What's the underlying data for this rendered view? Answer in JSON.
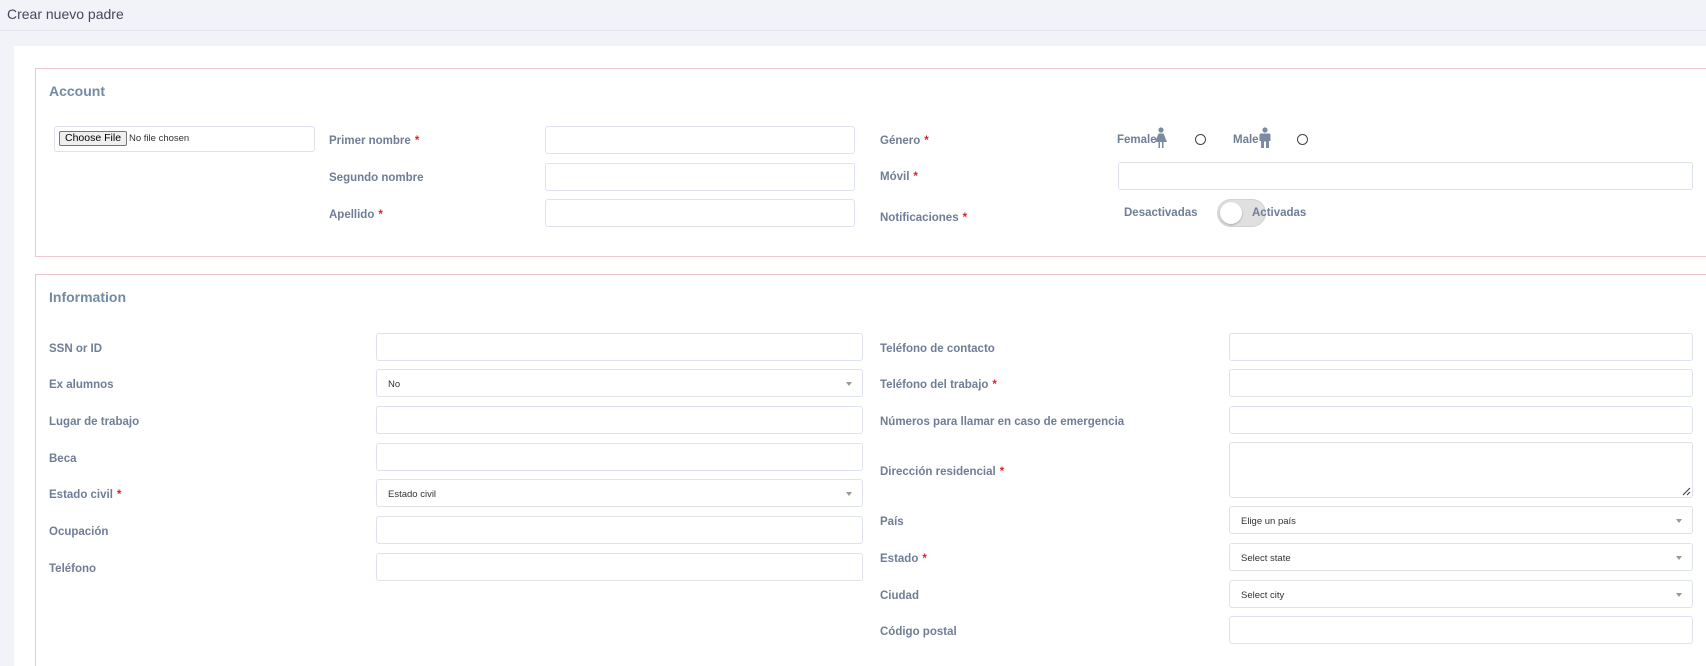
{
  "page": {
    "title": "Crear nuevo padre"
  },
  "account": {
    "title": "Account",
    "file_button": "Choose File",
    "file_status": "No file chosen",
    "first_name_label": "Primer nombre",
    "middle_name_label": "Segundo nombre",
    "last_name_label": "Apellido",
    "gender_label": "Género",
    "female_label": "Female",
    "male_label": "Male",
    "mobile_label": "Móvil",
    "notifications_label": "Notificaciones",
    "notif_off_label": "Desactivadas",
    "notif_on_label": "Activadas",
    "required_mark": "*"
  },
  "information": {
    "title": "Information",
    "ssn_label": "SSN or ID",
    "alumni_label": "Ex alumnos",
    "alumni_value": "No",
    "workplace_label": "Lugar de trabajo",
    "scholarship_label": "Beca",
    "marital_label": "Estado civil",
    "marital_value": "Estado civil",
    "occupation_label": "Ocupación",
    "phone_label": "Teléfono",
    "contact_phone_label": "Teléfono de contacto",
    "work_phone_label": "Teléfono del trabajo",
    "emergency_label": "Números para llamar en caso de emergencia",
    "address_label": "Dirección residencial",
    "country_label": "País",
    "country_value": "Elige un país",
    "state_label": "Estado",
    "state_value": "Select state",
    "city_label": "Ciudad",
    "city_value": "Select city",
    "zip_label": "Código postal",
    "required_mark": "*"
  },
  "colors": {
    "page_bg": "#f2f3f8",
    "section_border": "#f0c7cc",
    "label": "#6f7d96",
    "required": "#d9242b"
  },
  "icons": [
    "female-icon",
    "male-icon",
    "chevron-down-icon",
    "resize-handle-icon"
  ]
}
